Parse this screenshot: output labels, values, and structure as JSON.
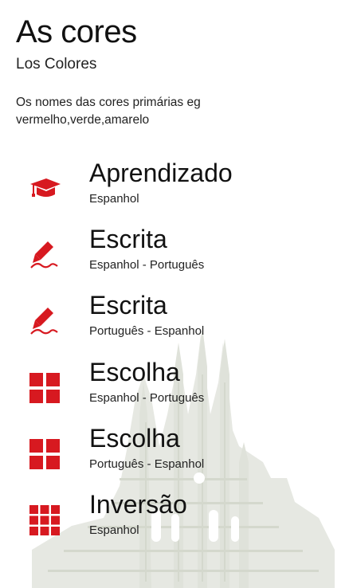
{
  "header": {
    "title": "As cores",
    "subtitle": "Los Colores",
    "description": "Os nomes das cores primárias eg vermelho,verde,amarelo"
  },
  "accent_color": "#d71920",
  "menu": [
    {
      "icon": "graduation-cap-icon",
      "title": "Aprendizado",
      "subtitle": "Espanhol"
    },
    {
      "icon": "pen-writing-icon",
      "title": "Escrita",
      "subtitle": "Espanhol - Português"
    },
    {
      "icon": "pen-writing-icon",
      "title": "Escrita",
      "subtitle": "Português - Espanhol"
    },
    {
      "icon": "four-squares-icon",
      "title": "Escolha",
      "subtitle": "Espanhol - Português"
    },
    {
      "icon": "four-squares-icon",
      "title": "Escolha",
      "subtitle": "Português - Espanhol"
    },
    {
      "icon": "nine-squares-icon",
      "title": "Inversão",
      "subtitle": "Espanhol"
    }
  ]
}
